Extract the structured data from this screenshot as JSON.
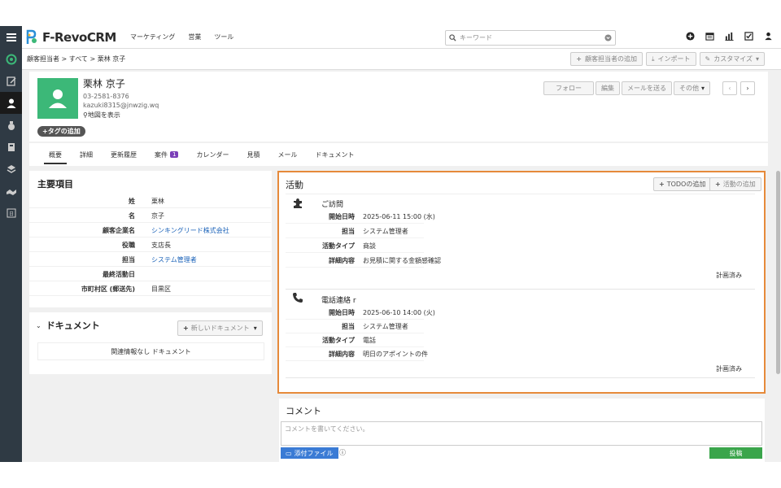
{
  "app": {
    "name": "F-RevoCRM"
  },
  "topnav": {
    "items": [
      "マーケティング",
      "営業",
      "ツール"
    ]
  },
  "search": {
    "placeholder": "キーワード"
  },
  "breadcrumb": "顧客担当者 > すべて > 栗林 京子",
  "breadbar_buttons": {
    "add": "顧客担当者の追加",
    "import": "インポート",
    "customize": "カスタマイズ"
  },
  "contact": {
    "name": "栗林 京子",
    "phone": "03-2581-8376",
    "email": "kazuki8315@jnwzig.wq",
    "map_link": "地図を表示",
    "tag_button": "タグの追加"
  },
  "header_buttons": {
    "follow": "フォロー",
    "edit": "編集",
    "send_mail": "メールを送る",
    "more": "その他"
  },
  "tabs": [
    {
      "label": "概要",
      "active": true
    },
    {
      "label": "詳細"
    },
    {
      "label": "更新履歴"
    },
    {
      "label": "案件",
      "badge": "1"
    },
    {
      "label": "カレンダー"
    },
    {
      "label": "見積"
    },
    {
      "label": "メール"
    },
    {
      "label": "ドキュメント"
    }
  ],
  "main_fields": {
    "title": "主要項目",
    "rows": [
      {
        "label": "姓",
        "value": "栗林"
      },
      {
        "label": "名",
        "value": "京子"
      },
      {
        "label": "顧客企業名",
        "value": "シンキングリード株式会社",
        "link": true
      },
      {
        "label": "役職",
        "value": "支店長"
      },
      {
        "label": "担当",
        "value": "システム管理者",
        "link": true
      },
      {
        "label": "最終活動日",
        "value": ""
      },
      {
        "label": "市町村区 (郵送先)",
        "value": "目黒区"
      }
    ]
  },
  "documents": {
    "title": "ドキュメント",
    "new_button": "新しいドキュメント",
    "empty": "関連情報なし ドキュメント"
  },
  "activities": {
    "title": "活動",
    "add_todo": "TODOの追加",
    "add_activity": "活動の追加",
    "items": [
      {
        "icon": "puzzle-icon",
        "title": "ご訪問",
        "fields": [
          {
            "label": "開始日時",
            "value": "2025-06-11 15:00 (水)"
          },
          {
            "label": "担当",
            "value": "システム管理者"
          },
          {
            "label": "活動タイプ",
            "value": "商談"
          },
          {
            "label": "詳細内容",
            "value": "お見積に関する金額感確認"
          }
        ],
        "status": "計画済み"
      },
      {
        "icon": "phone-icon",
        "title": "電話連絡 r",
        "fields": [
          {
            "label": "開始日時",
            "value": "2025-06-10 14:00 (火)"
          },
          {
            "label": "担当",
            "value": "システム管理者"
          },
          {
            "label": "活動タイプ",
            "value": "電話"
          },
          {
            "label": "詳細内容",
            "value": "明日のアポイントの件"
          }
        ],
        "status": "計画済み"
      }
    ]
  },
  "comments": {
    "title": "コメント",
    "placeholder": "コメントを書いてください。",
    "attach": "添付ファイル",
    "submit": "投稿"
  },
  "colors": {
    "accent_green": "#3cb878",
    "sidebar": "#2f3a44",
    "highlight": "#e68a3a",
    "link": "#1a62b8"
  }
}
